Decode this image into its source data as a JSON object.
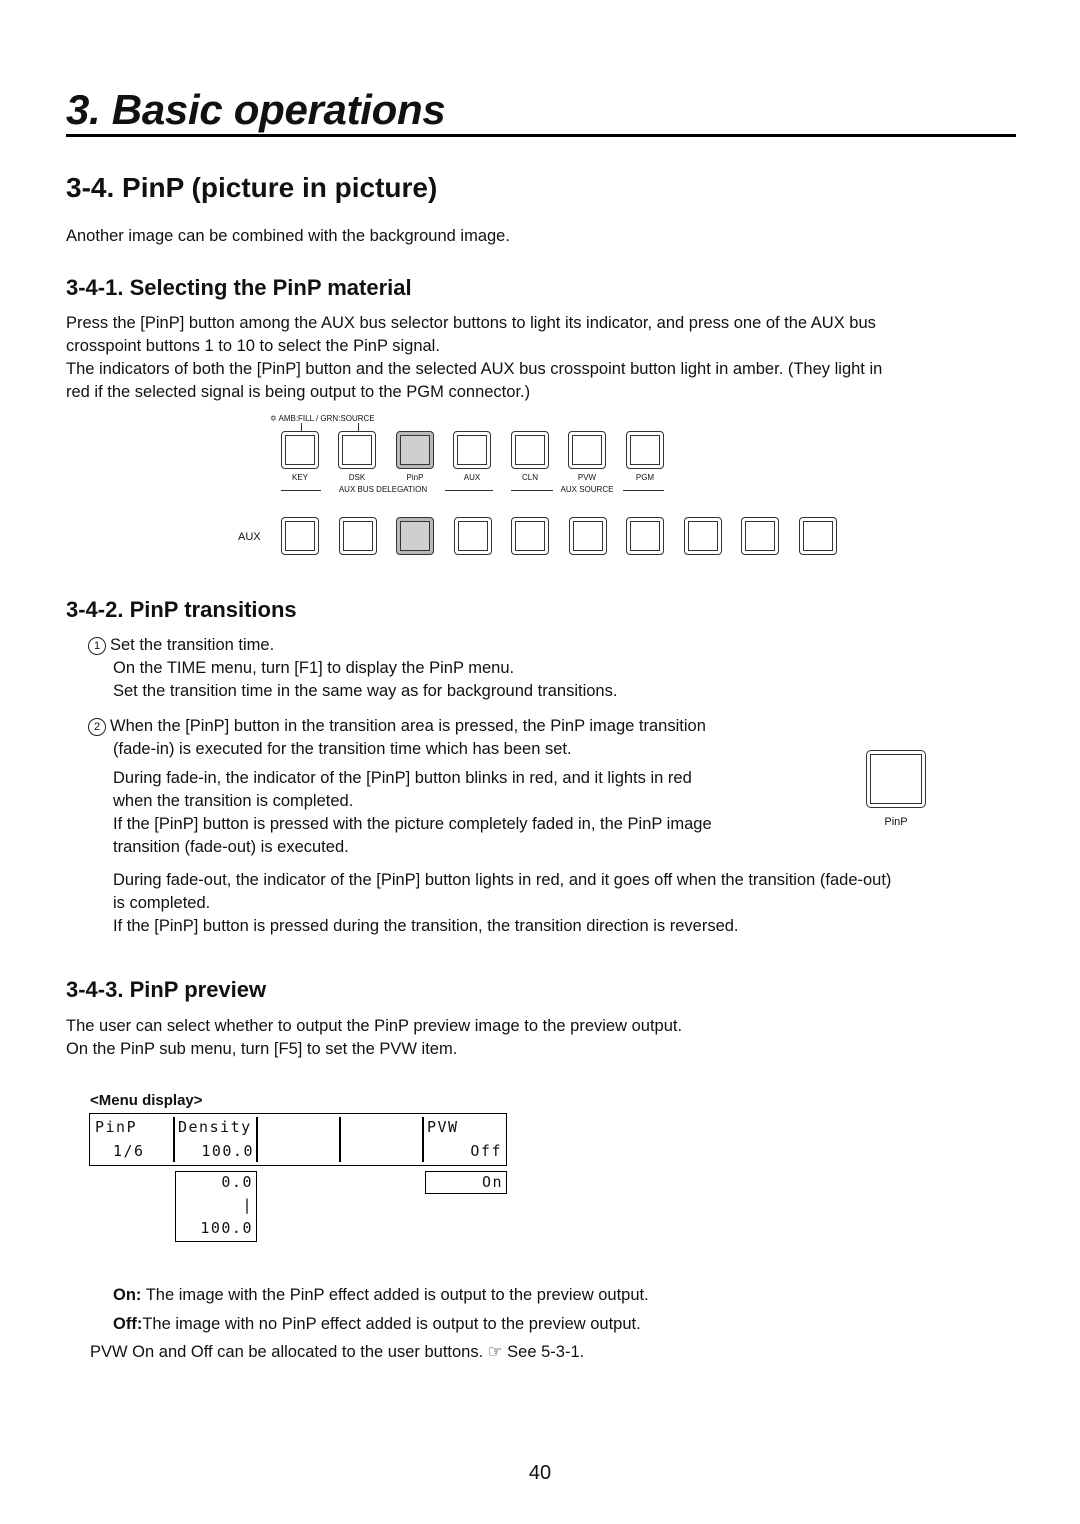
{
  "header": {
    "chapter_title": "3. Basic operations"
  },
  "section": {
    "title": "3-4. PinP (picture in picture)",
    "intro": "Another image can be combined with the background image."
  },
  "subsection_1": {
    "title": "3-4-1. Selecting the PinP material",
    "paragraphs": [
      "Press the [PinP] button among the AUX bus selector buttons to light its indicator, and press one of the AUX bus",
      "crosspoint buttons 1 to 10 to select the PinP signal.",
      "The indicators of both the [PinP] button and the selected AUX bus crosspoint button light in amber. (They light in",
      "red if the selected signal is being output to the PGM connector.)"
    ],
    "panel": {
      "legend": "AMB:FILL / GRN:SOURCE",
      "legend_icon": "✡",
      "buttons": [
        {
          "label": "KEY",
          "lit": false
        },
        {
          "label": "DSK",
          "lit": false
        },
        {
          "label": "PinP",
          "lit": true
        },
        {
          "label": "AUX",
          "lit": false
        },
        {
          "label": "CLN",
          "lit": false
        },
        {
          "label": "PVW",
          "lit": false
        },
        {
          "label": "PGM",
          "lit": false
        }
      ],
      "group_delegation": "AUX BUS DELEGATION",
      "group_source": "AUX SOURCE",
      "aux_row_label": "AUX",
      "aux_buttons_lit": [
        false,
        false,
        true,
        false,
        false,
        false,
        false,
        false,
        false,
        false
      ]
    }
  },
  "subsection_2": {
    "title": "3-4-2. PinP transitions",
    "step1_num": "1",
    "step1_lines": [
      "Set the transition time.",
      "On the TIME menu, turn [F1] to display the PinP menu.",
      "Set the transition time in the same way as for background transitions."
    ],
    "step2_num": "2",
    "step2_lines": [
      "When the [PinP] button in the transition area is pressed, the PinP image transition",
      "(fade-in) is executed for the transition time which has been set."
    ],
    "step2_detail": [
      "During fade-in, the indicator of the [PinP] button blinks in red, and it lights in red",
      "when the transition is completed.",
      "If the [PinP] button is pressed with the picture completely faded in, the PinP image",
      "transition (fade-out) is executed."
    ],
    "step2_detail2": [
      "During fade-out, the indicator of the [PinP] button lights in red, and it goes off when the transition (fade-out)",
      "is completed.",
      "If the [PinP] button is pressed during the transition, the transition direction is reversed."
    ],
    "side_button_label": "PinP"
  },
  "subsection_3": {
    "title": "3-4-3. PinP preview",
    "lines": [
      "The user can select whether to output the PinP preview image to the preview output.",
      "On the PinP sub menu, turn [F5] to set the PVW item."
    ],
    "menu_display_label": "<Menu display>",
    "menu": {
      "col1_top": "PinP",
      "col1_bottom": "1/6",
      "col2_top": "Density",
      "col2_bottom": "100.0",
      "col5_top": "PVW",
      "col5_bottom": "Off",
      "density_range_min": "0.0",
      "density_range_sep": "|",
      "density_range_max": "100.0",
      "pvw_option": "On"
    },
    "on_label": "On:",
    "on_text": "The image with the PinP effect added is output to the preview output.",
    "off_label": "Off:",
    "off_text": "The image with no PinP effect added is output to the preview output.",
    "note": "PVW On and Off can be allocated to the user buttons.",
    "note_icon": "☞",
    "note_ref": "See 5-3-1."
  },
  "footer": {
    "page_number": "40"
  }
}
